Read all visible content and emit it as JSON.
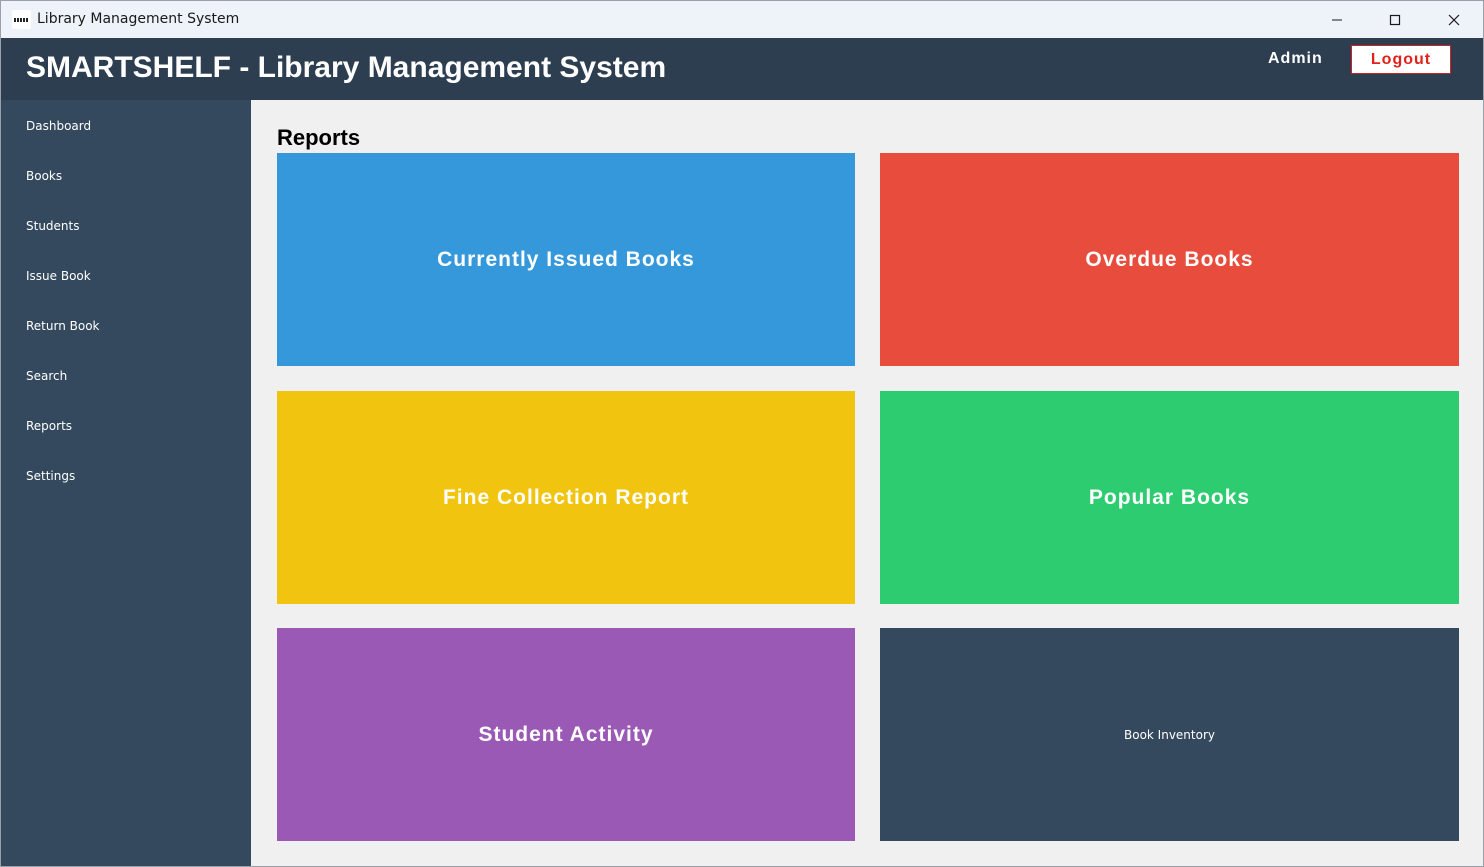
{
  "window": {
    "title": "Library Management System",
    "icons": {
      "app": "app-icon",
      "minimize": "minimize-icon",
      "maximize": "maximize-icon",
      "close": "close-icon"
    }
  },
  "header": {
    "title": "SMARTSHELF - Library Management System",
    "user": "Admin",
    "logout_label": "Logout",
    "background": "#2d3e50"
  },
  "sidebar": {
    "background": "#34495e",
    "items": [
      {
        "label": "Dashboard"
      },
      {
        "label": "Books"
      },
      {
        "label": "Students"
      },
      {
        "label": "Issue Book"
      },
      {
        "label": "Return Book"
      },
      {
        "label": "Search"
      },
      {
        "label": "Reports"
      },
      {
        "label": "Settings"
      }
    ]
  },
  "main": {
    "title": "Reports",
    "tiles": [
      {
        "label": "Currently Issued Books",
        "color": "#3598db"
      },
      {
        "label": "Overdue Books",
        "color": "#e74c3c"
      },
      {
        "label": "Fine Collection Report",
        "color": "#f1c40f"
      },
      {
        "label": "Popular Books",
        "color": "#2ecc71"
      },
      {
        "label": "Student Activity",
        "color": "#9b59b6"
      },
      {
        "label": "Book Inventory",
        "color": "#34495e"
      }
    ]
  },
  "colors": {
    "logout_text": "#e0221a",
    "content_background": "#f0f0f0"
  }
}
